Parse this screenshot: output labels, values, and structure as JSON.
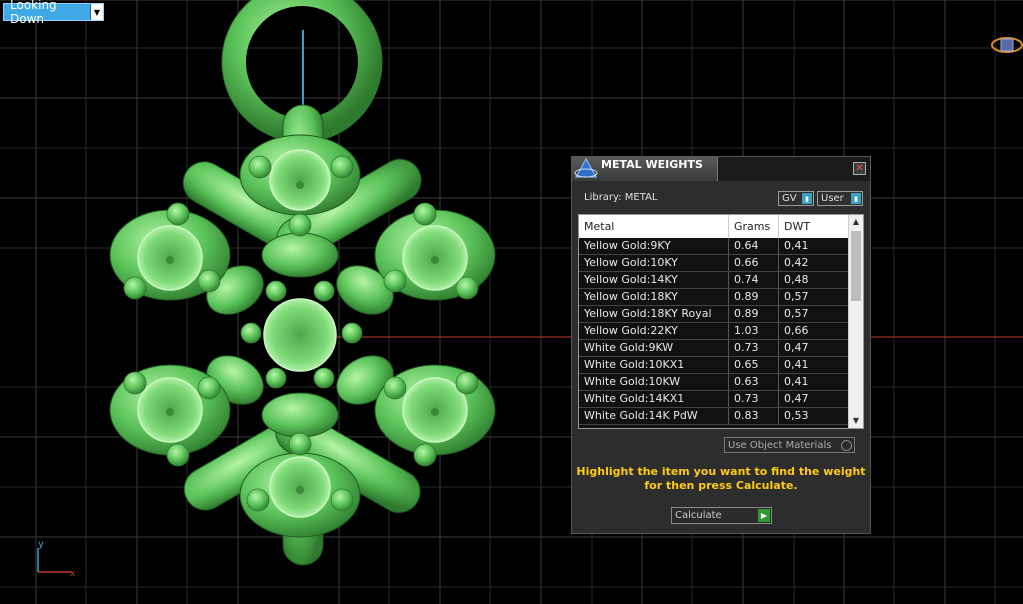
{
  "viewport": {
    "view_label": "Looking Down",
    "axis_x_label": "x",
    "axis_y_label": "y",
    "model_color": "#6ed66a"
  },
  "dialog": {
    "title": "METAL WEIGHTS",
    "close_glyph": "✕",
    "library_label": "Library: METAL",
    "gv_label": "GV",
    "user_label": "User",
    "columns": [
      "Metal",
      "Grams",
      "DWT"
    ],
    "rows": [
      {
        "metal": "Yellow Gold:9KY",
        "grams": "0.64",
        "dwt": "0,41"
      },
      {
        "metal": "Yellow Gold:10KY",
        "grams": "0.66",
        "dwt": "0,42"
      },
      {
        "metal": "Yellow Gold:14KY",
        "grams": "0.74",
        "dwt": "0,48"
      },
      {
        "metal": "Yellow Gold:18KY",
        "grams": "0.89",
        "dwt": "0,57"
      },
      {
        "metal": "Yellow Gold:18KY Royal",
        "grams": "0.89",
        "dwt": "0,57"
      },
      {
        "metal": "Yellow Gold:22KY",
        "grams": "1.03",
        "dwt": "0,66"
      },
      {
        "metal": "White Gold:9KW",
        "grams": "0.73",
        "dwt": "0,47"
      },
      {
        "metal": "White Gold:10KX1",
        "grams": "0.65",
        "dwt": "0,41"
      },
      {
        "metal": "White Gold:10KW",
        "grams": "0.63",
        "dwt": "0,41"
      },
      {
        "metal": "White Gold:14KX1",
        "grams": "0.73",
        "dwt": "0,47"
      },
      {
        "metal": "White Gold:14K PdW",
        "grams": "0.83",
        "dwt": "0,53"
      }
    ],
    "use_object_materials": "Use Object Materials",
    "hint": "Highlight the item you want to find the weight for then press Calculate.",
    "calculate_label": "Calculate",
    "accent": "#ffcc1a"
  }
}
